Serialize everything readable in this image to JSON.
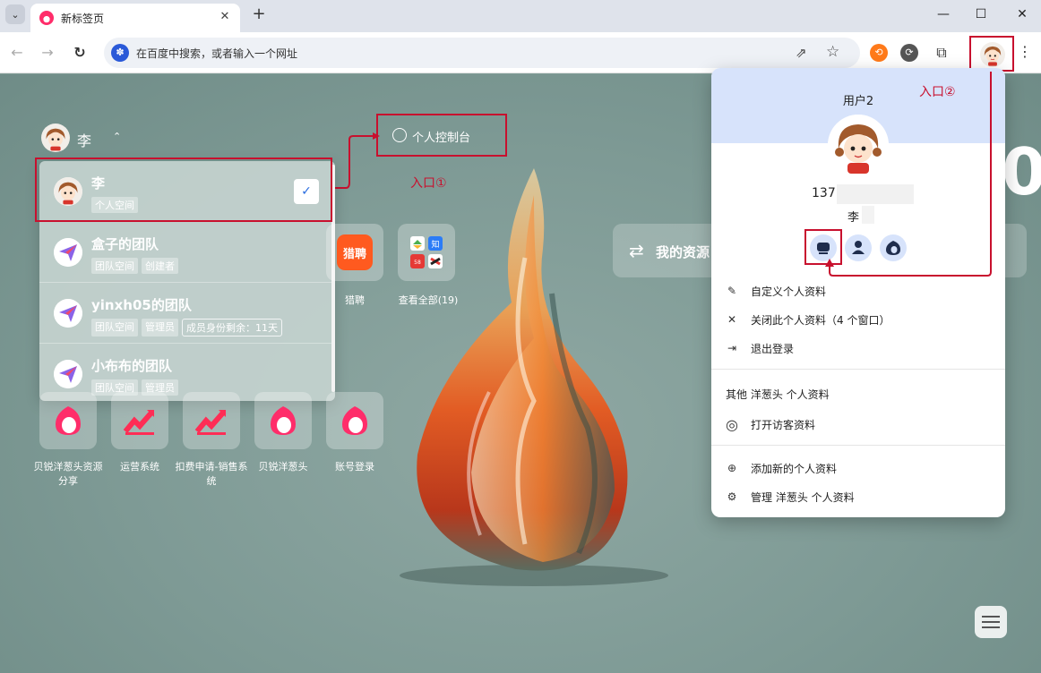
{
  "browser": {
    "tab_title": "新标签页",
    "tab_close": "✕",
    "new_tab": "+",
    "tab_dropdown": "⌄",
    "minimize": "—",
    "maximize": "☐",
    "close": "✕",
    "back": "←",
    "forward": "→",
    "reload": "↻",
    "omnibox_text": "在百度中搜索，或者输入一个网址",
    "omnibox_icon": "baidu-paw-icon",
    "share": "⇗",
    "bookmark": "☆",
    "menu": "⋮"
  },
  "page_user": {
    "name": "李",
    "caret": "⌃"
  },
  "console_link": {
    "label": "个人控制台"
  },
  "annotations": {
    "entry1": "入口①",
    "entry2": "入口②"
  },
  "workspaces": [
    {
      "name": "李",
      "tags": [
        "个人空间"
      ],
      "selected": true,
      "check": "✓"
    },
    {
      "name": "盒子的团队",
      "tags": [
        "团队空间",
        "创建者"
      ]
    },
    {
      "name": "yinxh05的团队",
      "tags": [
        "团队空间",
        "管理员"
      ],
      "outline_tag": "成员身份剩余：11天"
    },
    {
      "name": "小布布的团队",
      "tags": [
        "团队空间",
        "管理员"
      ]
    }
  ],
  "tiles": {
    "liepin": "猎聘",
    "view_all": "查看全部(19)",
    "bottom": [
      "贝锐洋葱头资源分享",
      "运营系统",
      "扣费申请-销售系统",
      "贝锐洋葱头",
      "账号登录"
    ]
  },
  "resources": {
    "label": "我的资源",
    "icon": "sync-icon"
  },
  "clock_fragment": "0",
  "profile_menu": {
    "user": "用户2",
    "phone_prefix": "137",
    "name": "李",
    "actions": [
      {
        "icon": "✎",
        "label": "自定义个人资料"
      },
      {
        "icon": "✕",
        "label": "关闭此个人资料（4 个窗口）"
      },
      {
        "icon": "⇥",
        "label": "退出登录"
      }
    ],
    "other_title": "其他 洋葱头 个人资料",
    "guest": {
      "icon": "◎",
      "label": "打开访客资料"
    },
    "footer": [
      {
        "icon": "⊕",
        "label": "添加新的个人资料"
      },
      {
        "icon": "⚙",
        "label": "管理 洋葱头 个人资料"
      }
    ]
  },
  "colors": {
    "annotation_red": "#c8102e",
    "menu_header": "#d7e3fb",
    "page_bg": "#7f9c96"
  }
}
